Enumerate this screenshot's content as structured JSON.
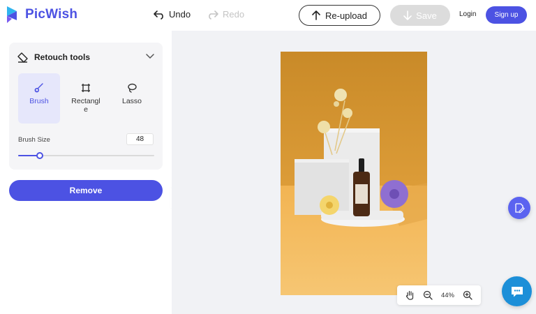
{
  "app": {
    "name": "PicWish",
    "brand_color": "#4c52e3"
  },
  "toolbar": {
    "undo_label": "Undo",
    "redo_label": "Redo",
    "reupload_label": "Re-upload",
    "save_label": "Save",
    "login_label": "Login",
    "signup_label": "Sign up"
  },
  "retouch": {
    "title": "Retouch tools",
    "tools": [
      {
        "label": "Brush",
        "icon": "brush-icon",
        "active": true
      },
      {
        "label": "Rectangl\ne",
        "icon": "rectangle-icon",
        "active": false
      },
      {
        "label": "Lasso",
        "icon": "lasso-icon",
        "active": false
      }
    ],
    "brush_size_label": "Brush Size",
    "brush_size_value": "48",
    "brush_size_fraction": 0.16
  },
  "remove_label": "Remove",
  "zoom": {
    "level": "44%"
  }
}
